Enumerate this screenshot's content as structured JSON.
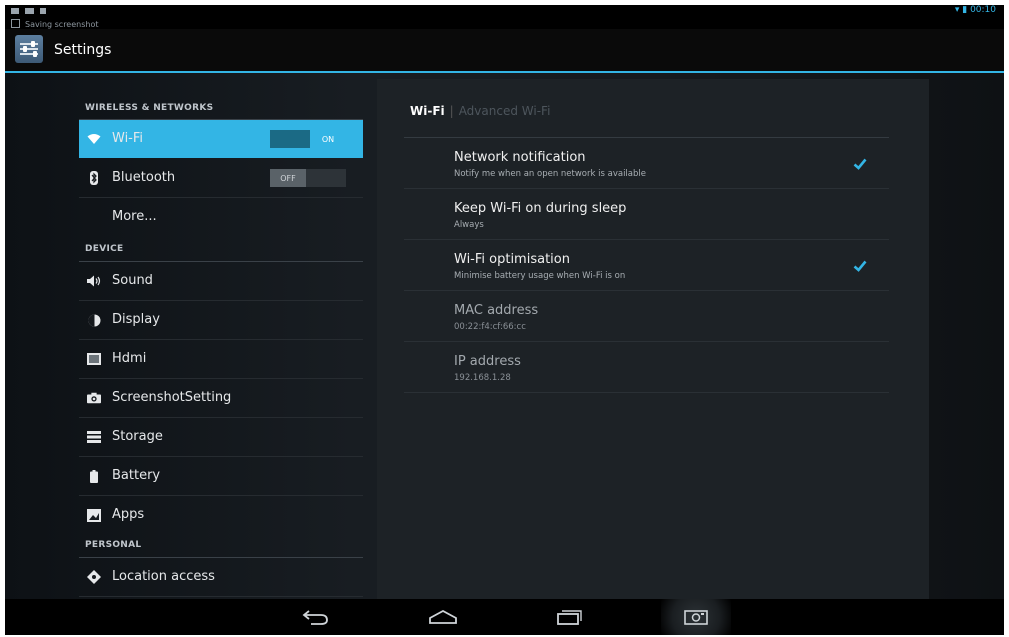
{
  "status_bar": {
    "notification": "Saving screenshot",
    "time": "00:10"
  },
  "action_bar": {
    "title": "Settings",
    "icon": "settings-sliders-icon"
  },
  "left_list": {
    "categories": {
      "wireless": "WIRELESS & NETWORKS",
      "device": "DEVICE",
      "personal": "PERSONAL"
    },
    "items": [
      {
        "label": "Wi-Fi",
        "icon": "wifi-icon",
        "toggle": "ON",
        "selected": true
      },
      {
        "label": "Bluetooth",
        "icon": "bluetooth-icon",
        "toggle": "OFF"
      },
      {
        "label": "More..."
      },
      {
        "label": "Sound",
        "icon": "speaker-icon"
      },
      {
        "label": "Display",
        "icon": "display-icon"
      },
      {
        "label": "Hdmi",
        "icon": "hdmi-icon"
      },
      {
        "label": "ScreenshotSetting",
        "icon": "camera-icon"
      },
      {
        "label": "Storage",
        "icon": "storage-icon"
      },
      {
        "label": "Battery",
        "icon": "battery-icon"
      },
      {
        "label": "Apps",
        "icon": "apps-icon"
      },
      {
        "label": "Location access",
        "icon": "location-icon"
      }
    ]
  },
  "right_panel": {
    "tabs": [
      {
        "label": "Wi-Fi"
      },
      {
        "label": "Advanced Wi-Fi"
      }
    ],
    "prefs": [
      {
        "title": "Network notification",
        "summary": "Notify me when an open network is available",
        "checked": true
      },
      {
        "title": "Keep Wi-Fi on during sleep",
        "summary": "Always"
      },
      {
        "title": "Wi-Fi optimisation",
        "summary": "Minimise battery usage when Wi-Fi is on",
        "checked": true
      },
      {
        "title": "MAC address",
        "summary": "00:22:f4:cf:66:cc"
      },
      {
        "title": "IP address",
        "summary": "192.168.1.28"
      }
    ]
  },
  "nav_bar": {
    "icons": [
      "back-icon",
      "home-icon",
      "recent-apps-icon",
      "screenshot-icon"
    ]
  },
  "colors": {
    "accent": "#33b5e5",
    "panel": "#1d2226",
    "background": "#000000"
  }
}
